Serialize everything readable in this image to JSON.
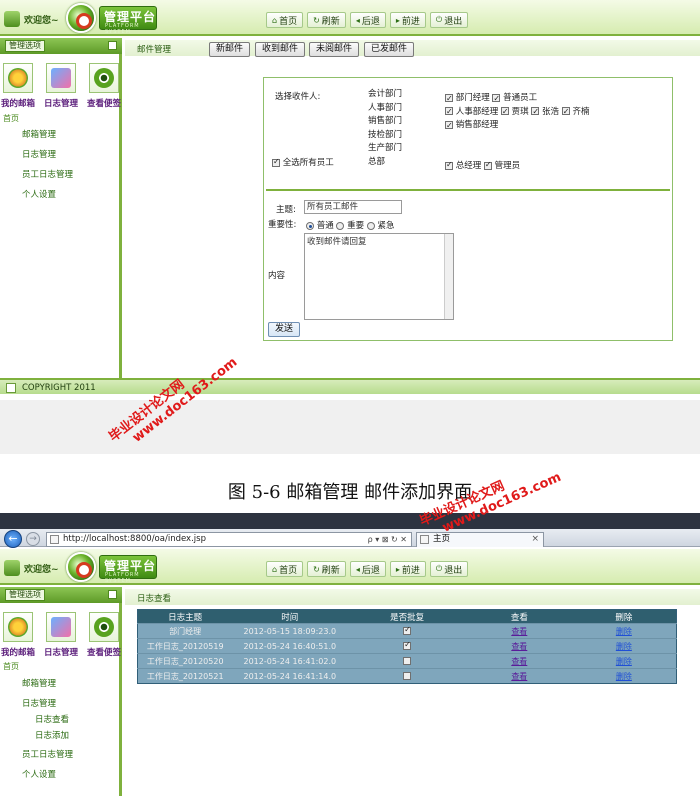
{
  "app": {
    "welcome": "欢迎您~",
    "logo_title": "管理平台",
    "logo_subtitle": "PLATFORM SYSTEM",
    "nav": [
      {
        "label": "首页",
        "glyph": "⌂"
      },
      {
        "label": "刷新",
        "glyph": "↻"
      },
      {
        "label": "后退",
        "glyph": "◂"
      },
      {
        "label": "前进",
        "glyph": "▸"
      },
      {
        "label": "退出",
        "glyph": "⏻"
      }
    ],
    "panel_title": "管理选项",
    "quick_icons": [
      "我的邮箱",
      "日志管理",
      "查看便签"
    ],
    "home_crumb": "首页",
    "footer": "COPYRIGHT 2011"
  },
  "screen1": {
    "menu": [
      "邮箱管理",
      "日志管理",
      "员工日志管理",
      "个人设置"
    ],
    "section_label": "邮件管理",
    "tabs": [
      "新邮件",
      "收到邮件",
      "未阅邮件",
      "已发邮件"
    ],
    "form": {
      "recipient_label": "选择收件人:",
      "select_all": "全选所有员工",
      "departments": [
        "会计部门",
        "人事部门",
        "销售部门",
        "技检部门",
        "生产部门",
        "总部"
      ],
      "roles_row1": [
        "部门经理",
        "普通员工"
      ],
      "roles_row2": [
        "人事部经理",
        "贾琪",
        "张浩",
        "齐楠"
      ],
      "roles_row3": [
        "销售部经理"
      ],
      "roles_hq": [
        "总经理",
        "管理员"
      ],
      "subject_label": "主题:",
      "subject_value": "所有员工邮件",
      "importance_label": "重要性:",
      "importance_options": [
        "普通",
        "重要",
        "紧急"
      ],
      "content_label": "内容",
      "content_value": "收到邮件请回复",
      "send_button": "发送"
    }
  },
  "caption": "图 5-6        邮箱管理  邮件添加界面",
  "watermarks": [
    "毕业设计论文网",
    "www.doc163.com"
  ],
  "browser": {
    "url": "http://localhost:8800/oa/index.jsp",
    "url_tools": "ρ ▾ ⊠ ↻ ✕",
    "tab_title": "主页",
    "tab_close": "×",
    "back_glyph": "←",
    "fwd_glyph": "→"
  },
  "screen2": {
    "menu": [
      "邮箱管理",
      "日志管理",
      "员工日志管理",
      "个人设置"
    ],
    "submenu": [
      "日志查看",
      "日志添加"
    ],
    "section_label": "日志查看",
    "table": {
      "headers": [
        "日志主题",
        "时间",
        "是否批复",
        "查看",
        "删除"
      ],
      "rows": [
        {
          "subject": "部门经理",
          "time": "2012-05-15 18:09:23.0",
          "approved": true,
          "view": "查看",
          "delete": "删除"
        },
        {
          "subject": "工作日志_20120519",
          "time": "2012-05-24 16:40:51.0",
          "approved": true,
          "view": "查看",
          "delete": "删除"
        },
        {
          "subject": "工作日志_20120520",
          "time": "2012-05-24 16:41:02.0",
          "approved": false,
          "view": "查看",
          "delete": "删除"
        },
        {
          "subject": "工作日志_20120521",
          "time": "2012-05-24 16:41:14.0",
          "approved": false,
          "view": "查看",
          "delete": "删除"
        }
      ]
    }
  }
}
